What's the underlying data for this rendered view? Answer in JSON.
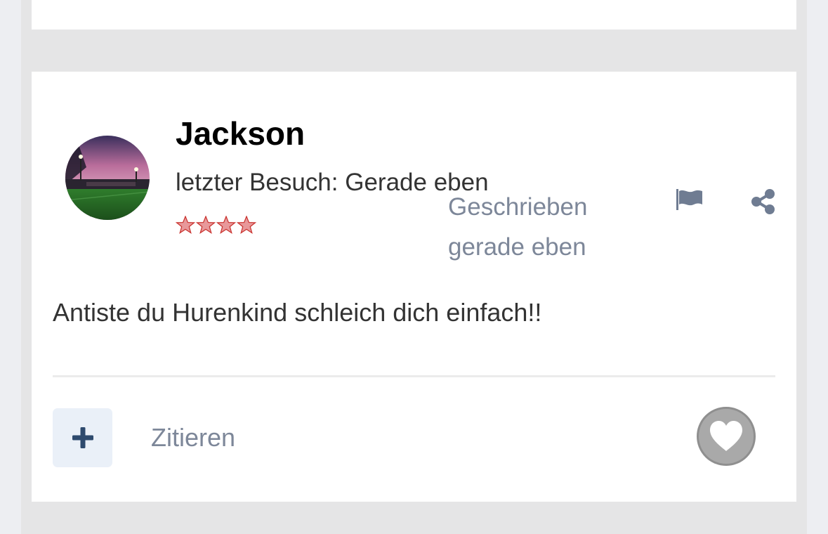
{
  "post": {
    "author": {
      "name": "Jackson",
      "last_visit": "letzter Besuch: Gerade eben",
      "avatar_icon": "stadium-photo-avatar",
      "rank_stars": 4
    },
    "posted_time": "Geschrieben gerade eben",
    "body": "Antiste du Hurenkind schleich dich einfach!!",
    "actions": {
      "flag_icon": "flag-icon",
      "share_icon": "share-icon",
      "add_icon": "plus-icon",
      "quote_label": "Zitieren",
      "like_icon": "heart-icon"
    }
  },
  "colors": {
    "meta_text": "#7d8799",
    "accent_dark_blue": "#2e4a6e",
    "star_red": "#d9534f",
    "like_grey": "#a9a9a9"
  }
}
